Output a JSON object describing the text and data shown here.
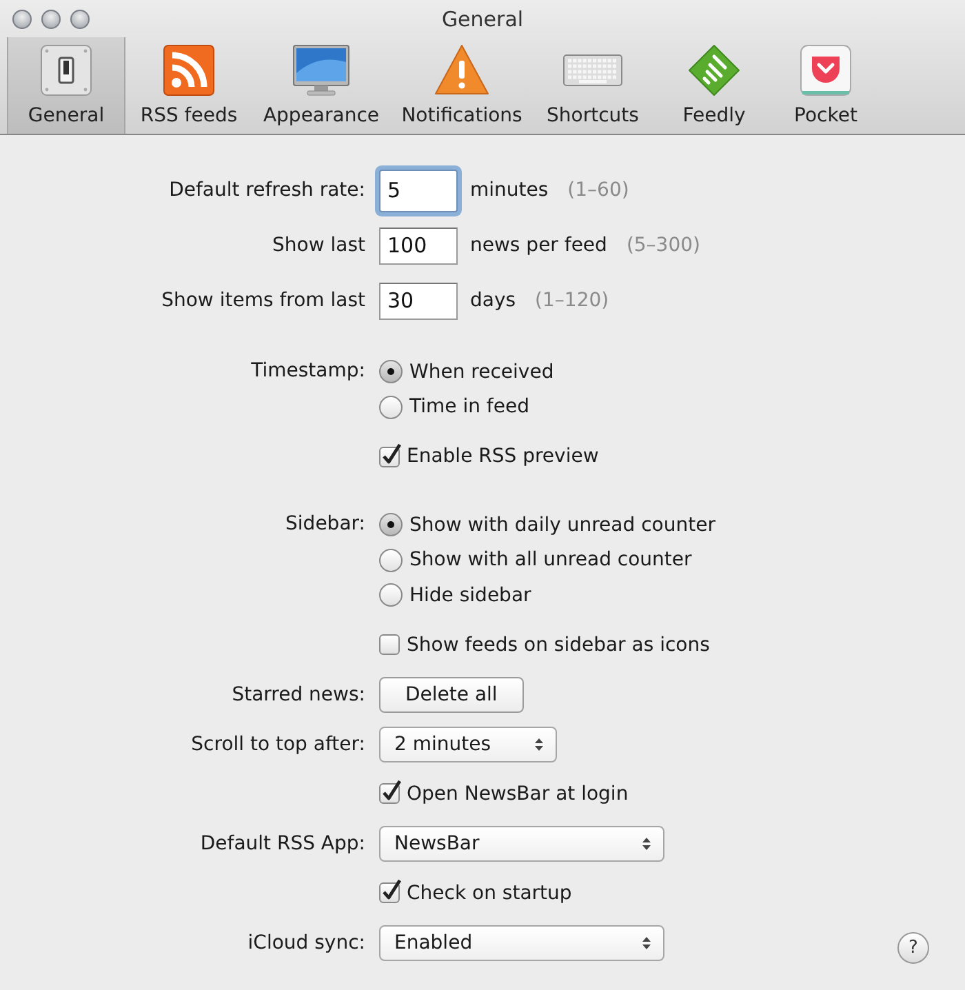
{
  "window": {
    "title": "General"
  },
  "toolbar": [
    {
      "label": "General",
      "kind": "general",
      "selected": true
    },
    {
      "label": "RSS feeds",
      "kind": "rss",
      "selected": false
    },
    {
      "label": "Appearance",
      "kind": "appearance",
      "selected": false
    },
    {
      "label": "Notifications",
      "kind": "notifications",
      "selected": false
    },
    {
      "label": "Shortcuts",
      "kind": "shortcuts",
      "selected": false
    },
    {
      "label": "Feedly",
      "kind": "feedly",
      "selected": false
    },
    {
      "label": "Pocket",
      "kind": "pocket",
      "selected": false
    }
  ],
  "sections": [
    {
      "rows": [
        {
          "kind": "number",
          "label": "Default refresh rate:",
          "value": "5",
          "focused": true,
          "unit": "minutes",
          "range": "(1–60)"
        },
        {
          "kind": "number",
          "label": "Show last",
          "value": "100",
          "focused": false,
          "unit": "news per feed",
          "range": "(5–300)"
        },
        {
          "kind": "number",
          "label": "Show items from last",
          "value": "30",
          "focused": false,
          "unit": "days",
          "range": "(1–120)"
        }
      ]
    },
    {
      "rows": [
        {
          "kind": "radio",
          "label": "Timestamp:",
          "options": [
            {
              "label": "When received",
              "selected": true
            },
            {
              "label": "Time in feed",
              "selected": false
            }
          ]
        },
        {
          "kind": "checkbox",
          "text": "Enable RSS preview",
          "checked": true
        }
      ]
    },
    {
      "rows": [
        {
          "kind": "radio",
          "label": "Sidebar:",
          "options": [
            {
              "label": "Show with daily unread counter",
              "selected": true
            },
            {
              "label": "Show with all unread counter",
              "selected": false
            },
            {
              "label": "Hide sidebar",
              "selected": false
            }
          ]
        },
        {
          "kind": "checkbox",
          "text": "Show feeds on sidebar as icons",
          "checked": false
        },
        {
          "kind": "button",
          "label": "Starred news:",
          "button": "Delete all"
        },
        {
          "kind": "compact_popup",
          "label": "Scroll to top after:",
          "value": "2 minutes"
        },
        {
          "kind": "checkbox",
          "text": "Open NewsBar at login",
          "checked": true
        },
        {
          "kind": "popup",
          "label": "Default RSS App:",
          "value": "NewsBar"
        },
        {
          "kind": "checkbox",
          "text": "Check on startup",
          "checked": true
        },
        {
          "kind": "popup",
          "label": "iCloud sync:",
          "value": "Enabled"
        }
      ]
    }
  ],
  "help_button": {
    "label": "?"
  }
}
